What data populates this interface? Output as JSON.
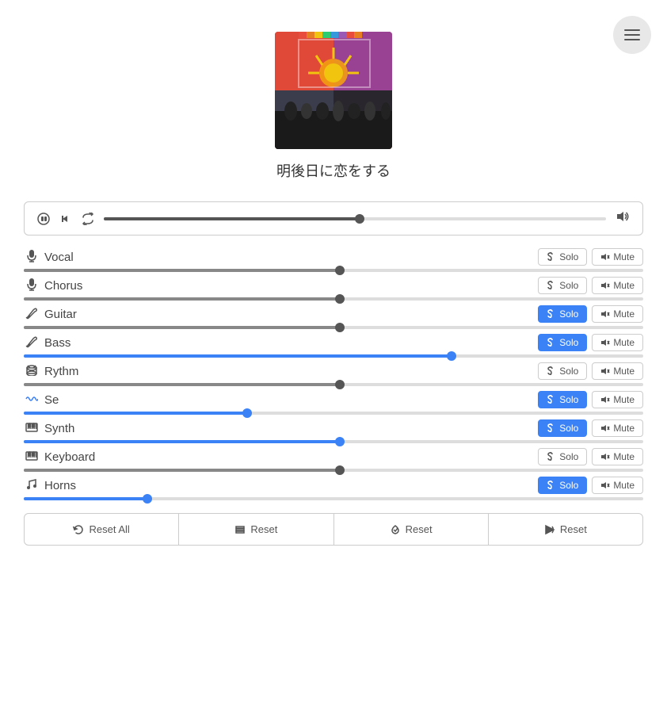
{
  "header": {
    "menu_label": "menu"
  },
  "song": {
    "title": "明後日に恋をする"
  },
  "transport": {
    "progress_percent": 51,
    "play_icon": "▶",
    "prev_icon": "⏮",
    "repeat_icon": "🔁",
    "volume_icon": "🔊"
  },
  "tracks": [
    {
      "name": "Vocal",
      "icon": "🎤",
      "slider_percent": 51,
      "slider_color": "gray",
      "solo_active": false,
      "mute_active": false
    },
    {
      "name": "Chorus",
      "icon": "🎤",
      "slider_percent": 51,
      "slider_color": "gray",
      "solo_active": false,
      "mute_active": false
    },
    {
      "name": "Guitar",
      "icon": "🎸",
      "slider_percent": 51,
      "slider_color": "gray",
      "solo_active": true,
      "mute_active": false
    },
    {
      "name": "Bass",
      "icon": "🎸",
      "slider_percent": 69,
      "slider_color": "blue",
      "solo_active": true,
      "mute_active": false
    },
    {
      "name": "Rythm",
      "icon": "🥁",
      "slider_percent": 51,
      "slider_color": "gray",
      "solo_active": false,
      "mute_active": false
    },
    {
      "name": "Se",
      "icon": "〰",
      "slider_percent": 36,
      "slider_color": "blue",
      "solo_active": true,
      "mute_active": false
    },
    {
      "name": "Synth",
      "icon": "🎹",
      "slider_percent": 51,
      "slider_color": "blue",
      "solo_active": true,
      "mute_active": false
    },
    {
      "name": "Keyboard",
      "icon": "🎹",
      "slider_percent": 51,
      "slider_color": "gray",
      "solo_active": false,
      "mute_active": false
    },
    {
      "name": "Horns",
      "icon": "🎵",
      "slider_percent": 20,
      "slider_color": "blue",
      "solo_active": true,
      "mute_active": false
    }
  ],
  "footer": {
    "reset_all_label": "Reset All",
    "reset1_label": "Reset",
    "reset2_label": "Reset",
    "reset3_label": "Reset",
    "reset_all_icon": "↺",
    "menu_icon": "≡",
    "solo_icon": "🔊",
    "mute_icon": "🔇"
  }
}
